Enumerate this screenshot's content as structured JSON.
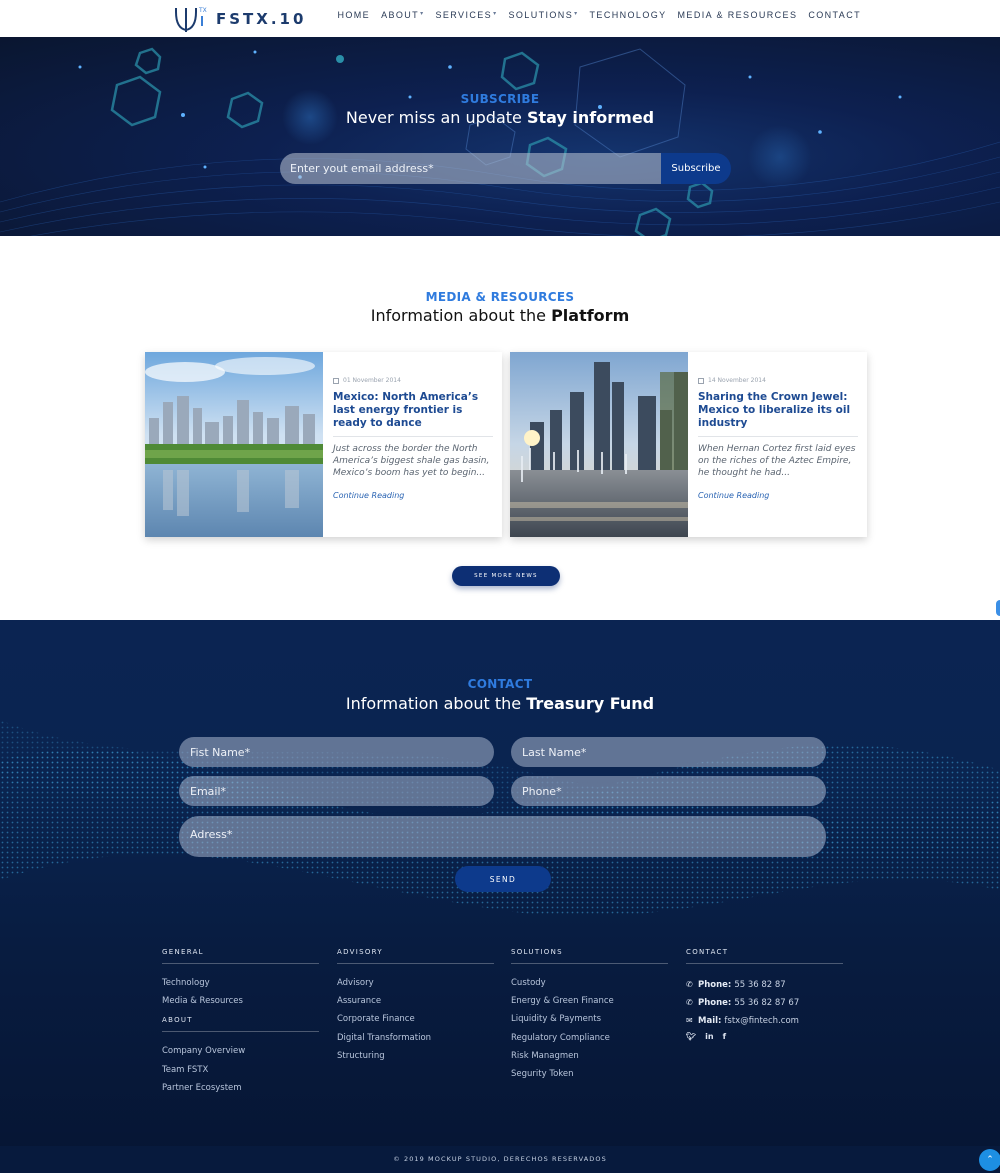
{
  "brand": {
    "logo_text": "FSTX.10",
    "accent": "#2f7bde",
    "primary_dark": "#0d2f74"
  },
  "nav": {
    "items": [
      {
        "label": "HOME",
        "has_dropdown": false
      },
      {
        "label": "ABOUT",
        "has_dropdown": true
      },
      {
        "label": "SERVICES",
        "has_dropdown": true
      },
      {
        "label": "SOLUTIONS",
        "has_dropdown": true
      },
      {
        "label": "TECHNOLOGY",
        "has_dropdown": false
      },
      {
        "label": "MEDIA & RESOURCES",
        "has_dropdown": false
      },
      {
        "label": "CONTACT",
        "has_dropdown": false
      }
    ]
  },
  "subscribe": {
    "kicker": "SUBSCRIBE",
    "title_plain": "Never miss an update ",
    "title_bold": "Stay informed",
    "email_placeholder": "Enter yout email address*",
    "button_label": "Subscribe"
  },
  "media": {
    "kicker": "MEDIA & RESOURCES",
    "title_plain": "Information about the ",
    "title_bold": "Platform",
    "cards": [
      {
        "date": "01 November 2014",
        "title": "Mexico: North America’s last energy frontier is ready to dance",
        "excerpt": "Just across the border the North America’s biggest shale gas basin, Mexico’s boom has yet to begin...",
        "link_label": "Continue Reading"
      },
      {
        "date": "14 November 2014",
        "title": "Sharing the Crown Jewel: Mexico to liberalize its oil industry",
        "excerpt": "When Hernan Cortez first laid eyes on the riches of the Aztec Empire, he thought he had...",
        "link_label": "Continue Reading"
      }
    ],
    "see_more_label": "SEE MORE NEWS"
  },
  "contact": {
    "kicker": "CONTACT",
    "title_plain": "Information about the ",
    "title_bold": "Treasury Fund",
    "fields": {
      "first_name": "Fist Name*",
      "last_name": "Last Name*",
      "email": "Email*",
      "phone": "Phone*",
      "address": "Adress*"
    },
    "send_label": "SEND"
  },
  "footer": {
    "general": {
      "heading": "GENERAL",
      "links": [
        "Technology",
        "Media & Resources"
      ]
    },
    "about": {
      "heading": "ABOUT",
      "links": [
        "Company Overview",
        "Team FSTX",
        "Partner Ecosystem"
      ]
    },
    "advisory": {
      "heading": "ADVISORY",
      "links": [
        "Advisory",
        "Assurance",
        "Corporate Finance",
        "Digital Transformation",
        "Structuring"
      ]
    },
    "solutions": {
      "heading": "SOLUTIONS",
      "links": [
        "Custody",
        "Energy & Green Finance",
        "Liquidity & Payments",
        "Regulatory Compliance",
        "Risk Managmen",
        "Segurity Token"
      ]
    },
    "contact": {
      "heading": "CONTACT",
      "phone_label": "Phone:",
      "phone_1": "55 36 82 87",
      "phone_2": "55 36 82 87 67",
      "mail_label": "Mail:",
      "mail": "fstx@fintech.com",
      "social_icons": [
        "twitter-icon",
        "linkedin-icon",
        "facebook-icon"
      ]
    },
    "copyright": "© 2019 MOCKUP STUDIO, DERECHOS RESERVADOS"
  }
}
